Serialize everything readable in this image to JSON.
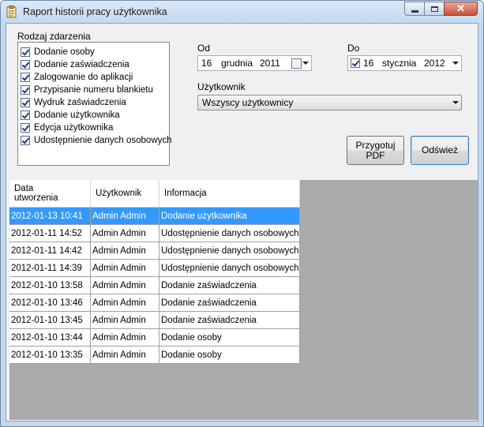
{
  "window": {
    "title": "Raport historii pracy użytkownika",
    "close_glyph": "✕"
  },
  "event_type": {
    "label": "Rodzaj zdarzenia",
    "items": [
      {
        "label": "Dodanie osoby",
        "checked": true
      },
      {
        "label": "Dodanie zaświadczenia",
        "checked": true
      },
      {
        "label": "Zalogowanie do aplikacji",
        "checked": true
      },
      {
        "label": "Przypisanie numeru blankietu",
        "checked": true
      },
      {
        "label": "Wydruk zaświadczenia",
        "checked": true
      },
      {
        "label": "Dodanie użytkownika",
        "checked": true
      },
      {
        "label": "Edycja użytkownika",
        "checked": true
      },
      {
        "label": "Udostępnienie danych osobowych",
        "checked": true
      }
    ]
  },
  "from_date": {
    "label": "Od",
    "day": "16",
    "month": "grudnia",
    "year": "2011"
  },
  "to_date": {
    "label": "Do",
    "checked": true,
    "day": "16",
    "month": "stycznia",
    "year": "2012"
  },
  "user": {
    "label": "Użytkownik",
    "value": "Wszyscy użytkownicy"
  },
  "buttons": {
    "pdf_line1": "Przygotuj",
    "pdf_line2": "PDF",
    "refresh": "Odśwież"
  },
  "grid": {
    "headers": {
      "date_line1": "Data",
      "date_line2": "utworzenia",
      "user": "Użytkownik",
      "info": "Informacja"
    },
    "selected_row": 0,
    "rows": [
      {
        "date": "2012-01-13 10:41",
        "user": "Admin Admin",
        "info": "Dodanie użytkownika"
      },
      {
        "date": "2012-01-11 14:52",
        "user": "Admin Admin",
        "info": "Udostępnienie danych osobowych"
      },
      {
        "date": "2012-01-11 14:42",
        "user": "Admin Admin",
        "info": "Udostępnienie danych osobowych"
      },
      {
        "date": "2012-01-11 14:39",
        "user": "Admin Admin",
        "info": "Udostępnienie danych osobowych"
      },
      {
        "date": "2012-01-10 13:58",
        "user": "Admin Admin",
        "info": "Dodanie zaświadczenia"
      },
      {
        "date": "2012-01-10 13:46",
        "user": "Admin Admin",
        "info": "Dodanie zaświadczenia"
      },
      {
        "date": "2012-01-10 13:45",
        "user": "Admin Admin",
        "info": "Dodanie zaświadczenia"
      },
      {
        "date": "2012-01-10 13:44",
        "user": "Admin Admin",
        "info": "Dodanie osoby"
      },
      {
        "date": "2012-01-10 13:35",
        "user": "Admin Admin",
        "info": "Dodanie osoby"
      }
    ]
  }
}
